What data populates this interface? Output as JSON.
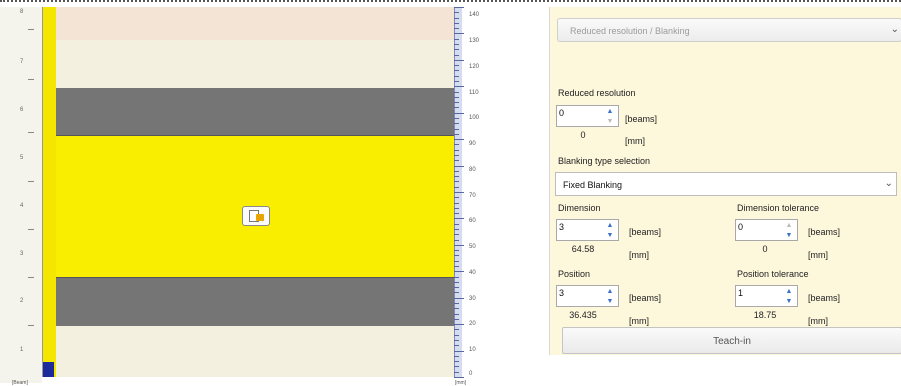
{
  "visualization": {
    "left_axis_labels": [
      "8",
      "7",
      "6",
      "5",
      "4",
      "3",
      "2",
      "1"
    ],
    "right_axis_labels": [
      "140",
      "130",
      "120",
      "110",
      "100",
      "90",
      "80",
      "70",
      "60",
      "50",
      "40",
      "30",
      "20",
      "10",
      "0"
    ],
    "left_axis_unit": "[Beam]",
    "right_axis_unit": "[mm]",
    "colors": {
      "pink_zone": "#f4e4d6",
      "cream_zone": "#f3f0e0",
      "blanked_zone": "#f9ee00",
      "tolerance_zone": "#757575",
      "beam_strip": "#f5e600",
      "selected_beam": "#1c2a9a"
    },
    "icon": "lock-document-icon"
  },
  "panel": {
    "section_title": "Reduced resolution / Blanking",
    "reduced_resolution": {
      "label": "Reduced resolution",
      "value": "0",
      "unit_beams": "[beams]",
      "calc_value": "0",
      "unit_mm": "[mm]"
    },
    "blanking_type": {
      "label": "Blanking type selection",
      "selected": "Fixed Blanking"
    },
    "dimension": {
      "label": "Dimension",
      "value": "3",
      "unit_beams": "[beams]",
      "calc_value": "64.58",
      "unit_mm": "[mm]"
    },
    "dimension_tolerance": {
      "label": "Dimension tolerance",
      "value": "0",
      "unit_beams": "[beams]",
      "calc_value": "0",
      "unit_mm": "[mm]"
    },
    "position": {
      "label": "Position",
      "value": "3",
      "unit_beams": "[beams]",
      "calc_value": "36.435",
      "unit_mm": "[mm]"
    },
    "position_tolerance": {
      "label": "Position tolerance",
      "value": "1",
      "unit_beams": "[beams]",
      "calc_value": "18.75",
      "unit_mm": "[mm]"
    },
    "teach_in_label": "Teach-in",
    "background": "#fdf7dc"
  }
}
